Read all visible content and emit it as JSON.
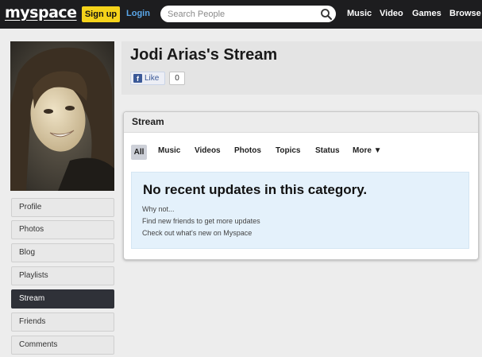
{
  "topbar": {
    "logo": "myspace",
    "signup_label": "Sign up",
    "login_label": "Login",
    "search_placeholder": "Search People",
    "nav": [
      "Music",
      "Video",
      "Games",
      "Browse"
    ]
  },
  "profile": {
    "title": "Jodi Arias's Stream",
    "like_label": "Like",
    "like_count": "0"
  },
  "sidebar": {
    "items": [
      {
        "label": "Profile"
      },
      {
        "label": "Photos"
      },
      {
        "label": "Blog"
      },
      {
        "label": "Playlists"
      },
      {
        "label": "Stream",
        "active": true
      },
      {
        "label": "Friends"
      },
      {
        "label": "Comments"
      }
    ]
  },
  "stream": {
    "title": "Stream",
    "tabs": [
      "All",
      "Music",
      "Videos",
      "Photos",
      "Topics",
      "Status",
      "More ▼"
    ],
    "active_tab": "All",
    "empty_heading": "No recent updates in this category.",
    "why_not": "Why not...",
    "suggestion_1": "Find new friends to get more updates",
    "suggestion_2": "Check out what's new on Myspace"
  },
  "colors": {
    "topbar_bg": "#1d1d1f",
    "signup_bg": "#f5d31a",
    "login_text": "#5aa7ea",
    "active_sidebar_bg": "#2f3138",
    "empty_box_bg": "#e4f1fb"
  }
}
